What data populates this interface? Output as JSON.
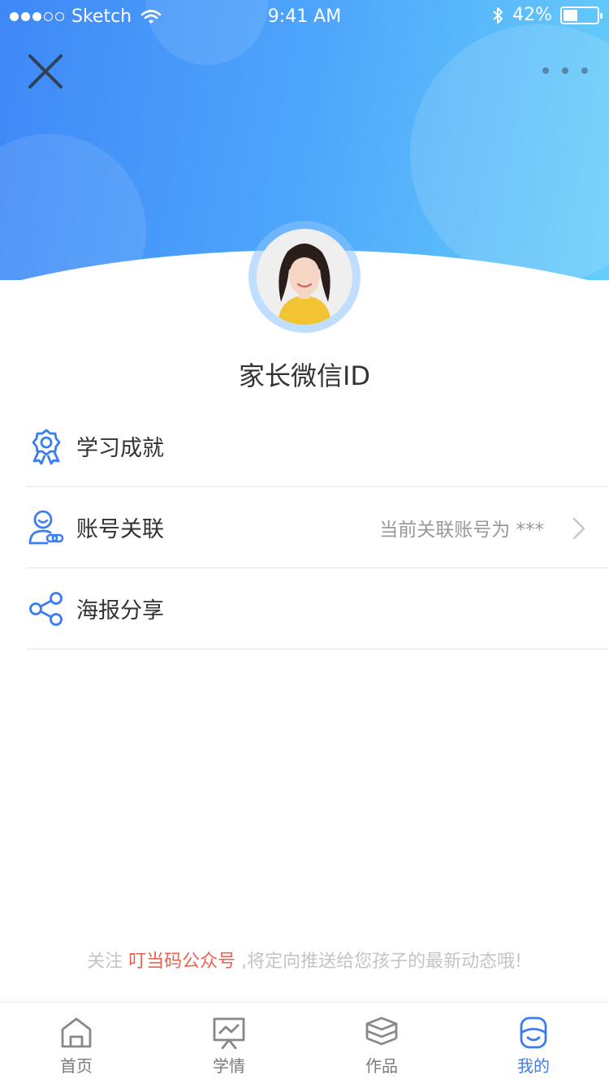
{
  "status_bar": {
    "carrier": "Sketch",
    "time": "9:41 AM",
    "battery": "42%",
    "battery_level": 0.42
  },
  "header": {
    "close_icon": "close-icon",
    "more_icon": "more-horizontal-icon"
  },
  "profile": {
    "name": "家长微信ID"
  },
  "menu": {
    "items": [
      {
        "label": "学习成就",
        "icon": "award-medal-icon"
      },
      {
        "label": "账号关联",
        "icon": "user-link-icon",
        "value": "当前关联账号为 ***"
      },
      {
        "label": "海报分享",
        "icon": "share-icon"
      }
    ]
  },
  "footer_note": {
    "prefix": "关注 ",
    "highlight": "叮当码公众号",
    "suffix": " ,将定向推送给您孩子的最新动态哦!"
  },
  "tabbar": {
    "tabs": [
      {
        "label": "首页",
        "icon": "home-icon"
      },
      {
        "label": "学情",
        "icon": "chart-board-icon"
      },
      {
        "label": "作品",
        "icon": "layers-icon"
      },
      {
        "label": "我的",
        "icon": "profile-icon",
        "active": true
      }
    ]
  },
  "colors": {
    "accent": "#3b7df0",
    "header_start": "#3f88f7",
    "header_end": "#66cefa",
    "highlight": "#f0604e"
  }
}
